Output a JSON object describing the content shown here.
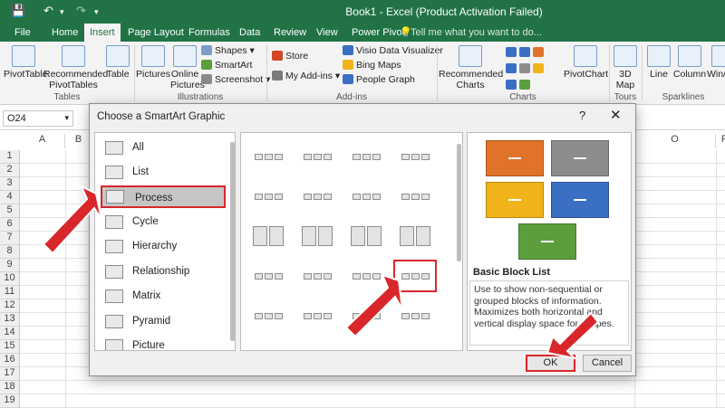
{
  "window": {
    "title": "Book1 - Excel (Product Activation Failed)",
    "tell_me": "Tell me what you want to do..."
  },
  "tabs": [
    "File",
    "Home",
    "Insert",
    "Page Layout",
    "Formulas",
    "Data",
    "Review",
    "View",
    "Power Pivot"
  ],
  "active_tab": "Insert",
  "ribbon": {
    "tables": {
      "pivottable": "PivotTable",
      "recommended": "Recommended PivotTables",
      "table": "Table",
      "group": "Tables"
    },
    "illustrations": {
      "pictures": "Pictures",
      "online": "Online Pictures",
      "shapes": "Shapes",
      "smartart": "SmartArt",
      "screenshot": "Screenshot",
      "group": "Illustrations"
    },
    "addins": {
      "store": "Store",
      "myaddins": "My Add-ins",
      "visio": "Visio Data Visualizer",
      "bing": "Bing Maps",
      "people": "People Graph",
      "group": "Add-ins"
    },
    "charts": {
      "recommended": "Recommended Charts",
      "pivotchart": "PivotChart",
      "map3d": "3D Map",
      "group": "Charts",
      "tours": "Tours"
    },
    "sparklines": {
      "line": "Line",
      "column": "Column",
      "winloss": "Win/Loss",
      "group": "Sparklines"
    }
  },
  "formula_bar": {
    "namebox": "O24"
  },
  "columns": [
    "A",
    "B",
    "O",
    "P"
  ],
  "rows": [
    "1",
    "2",
    "3",
    "4",
    "5",
    "6",
    "7",
    "8",
    "9",
    "10",
    "11",
    "12",
    "13",
    "14",
    "15",
    "16",
    "17",
    "18",
    "19"
  ],
  "dialog": {
    "title": "Choose a SmartArt Graphic",
    "help": "?",
    "close": "✕",
    "categories": [
      "All",
      "List",
      "Process",
      "Cycle",
      "Hierarchy",
      "Relationship",
      "Matrix",
      "Pyramid",
      "Picture"
    ],
    "selected_category": "Process",
    "preview_title": "Basic Block List",
    "preview_desc": "Use to show non-sequential or grouped blocks of information. Maximizes both horizontal and vertical display space for shapes.",
    "ok": "OK",
    "cancel": "Cancel"
  },
  "colors": {
    "excel_green": "#217346",
    "highlight_red": "#d9262b",
    "orange": "#e0722a",
    "gray": "#8c8c8c",
    "gold": "#f0b41a",
    "blue": "#3b6fc4",
    "green": "#5c9e3c"
  }
}
